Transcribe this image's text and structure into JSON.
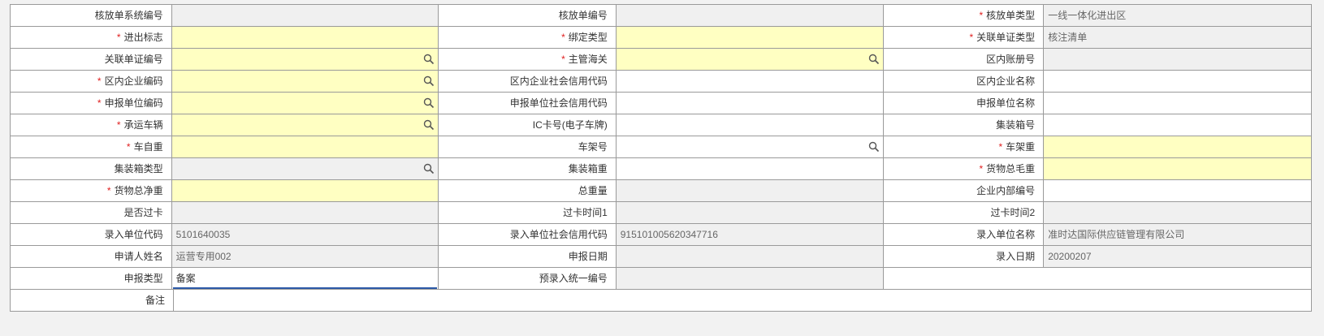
{
  "rows": [
    [
      {
        "label": "核放单系统编号",
        "required": false,
        "value": "",
        "kind": "ro",
        "search": false
      },
      {
        "label": "核放单编号",
        "required": false,
        "value": "",
        "kind": "ro",
        "search": false
      },
      {
        "label": "核放单类型",
        "required": true,
        "value": "一线一体化进出区",
        "kind": "ro",
        "search": false
      }
    ],
    [
      {
        "label": "进出标志",
        "required": true,
        "value": "",
        "kind": "req",
        "search": false
      },
      {
        "label": "绑定类型",
        "required": true,
        "value": "",
        "kind": "req",
        "search": false
      },
      {
        "label": "关联单证类型",
        "required": true,
        "value": "核注清单",
        "kind": "ro",
        "search": false
      }
    ],
    [
      {
        "label": "关联单证编号",
        "required": false,
        "value": "",
        "kind": "req",
        "search": true
      },
      {
        "label": "主管海关",
        "required": true,
        "value": "",
        "kind": "req",
        "search": true
      },
      {
        "label": "区内账册号",
        "required": false,
        "value": "",
        "kind": "ro",
        "search": false
      }
    ],
    [
      {
        "label": "区内企业编码",
        "required": true,
        "value": "",
        "kind": "req",
        "search": true
      },
      {
        "label": "区内企业社会信用代码",
        "required": false,
        "value": "",
        "kind": "plain",
        "search": false
      },
      {
        "label": "区内企业名称",
        "required": false,
        "value": "",
        "kind": "plain",
        "search": false
      }
    ],
    [
      {
        "label": "申报单位编码",
        "required": true,
        "value": "",
        "kind": "req",
        "search": true
      },
      {
        "label": "申报单位社会信用代码",
        "required": false,
        "value": "",
        "kind": "plain",
        "search": false
      },
      {
        "label": "申报单位名称",
        "required": false,
        "value": "",
        "kind": "plain",
        "search": false
      }
    ],
    [
      {
        "label": "承运车辆",
        "required": true,
        "value": "",
        "kind": "req",
        "search": true
      },
      {
        "label": "IC卡号(电子车牌)",
        "required": false,
        "value": "",
        "kind": "plain",
        "search": false
      },
      {
        "label": "集装箱号",
        "required": false,
        "value": "",
        "kind": "plain",
        "search": false
      }
    ],
    [
      {
        "label": "车自重",
        "required": true,
        "value": "",
        "kind": "req",
        "search": false
      },
      {
        "label": "车架号",
        "required": false,
        "value": "",
        "kind": "plain",
        "search": true
      },
      {
        "label": "车架重",
        "required": true,
        "value": "",
        "kind": "req",
        "search": false
      }
    ],
    [
      {
        "label": "集装箱类型",
        "required": false,
        "value": "",
        "kind": "ro",
        "search": true
      },
      {
        "label": "集装箱重",
        "required": false,
        "value": "",
        "kind": "plain",
        "search": false
      },
      {
        "label": "货物总毛重",
        "required": true,
        "value": "",
        "kind": "req",
        "search": false
      }
    ],
    [
      {
        "label": "货物总净重",
        "required": true,
        "value": "",
        "kind": "req",
        "search": false
      },
      {
        "label": "总重量",
        "required": false,
        "value": "",
        "kind": "ro",
        "search": false
      },
      {
        "label": "企业内部编号",
        "required": false,
        "value": "",
        "kind": "plain",
        "search": false
      }
    ],
    [
      {
        "label": "是否过卡",
        "required": false,
        "value": "",
        "kind": "ro",
        "search": false
      },
      {
        "label": "过卡时间1",
        "required": false,
        "value": "",
        "kind": "ro",
        "search": false
      },
      {
        "label": "过卡时间2",
        "required": false,
        "value": "",
        "kind": "ro",
        "search": false
      }
    ],
    [
      {
        "label": "录入单位代码",
        "required": false,
        "value": "5101640035",
        "kind": "ro",
        "search": false
      },
      {
        "label": "录入单位社会信用代码",
        "required": false,
        "value": "915101005620347716",
        "kind": "ro",
        "search": false
      },
      {
        "label": "录入单位名称",
        "required": false,
        "value": "准时达国际供应链管理有限公司",
        "kind": "ro",
        "search": false
      }
    ],
    [
      {
        "label": "申请人姓名",
        "required": false,
        "value": "运营专用002",
        "kind": "ro",
        "search": false
      },
      {
        "label": "申报日期",
        "required": false,
        "value": "",
        "kind": "ro",
        "search": false
      },
      {
        "label": "录入日期",
        "required": false,
        "value": "20200207",
        "kind": "ro",
        "search": false
      }
    ]
  ],
  "declare_type": {
    "label": "申报类型",
    "value": "备案"
  },
  "pre_entry": {
    "label": "预录入统一编号",
    "value": ""
  },
  "remark": {
    "label": "备注",
    "value": ""
  }
}
